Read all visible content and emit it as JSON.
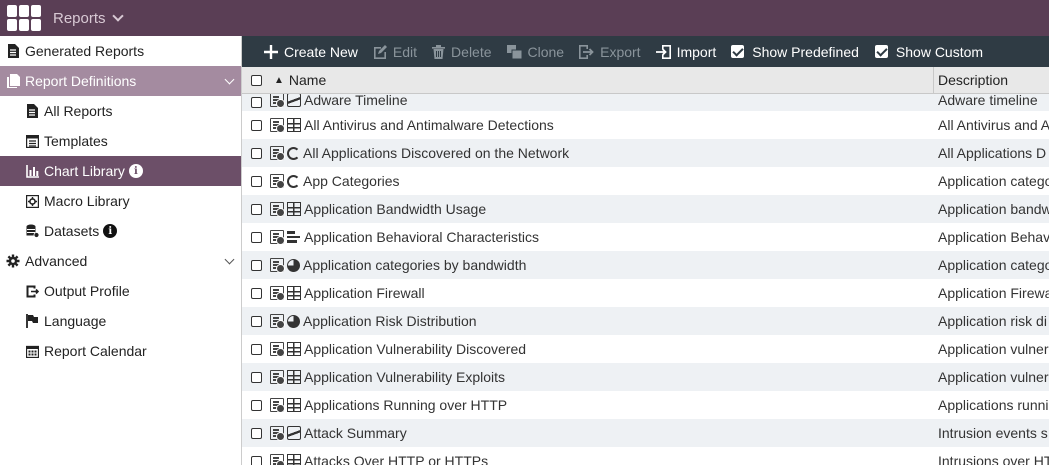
{
  "header": {
    "module_label": "Reports"
  },
  "sidebar": {
    "items": [
      {
        "label": "Generated Reports",
        "icon": "file-text-icon",
        "level": "top"
      },
      {
        "label": "Report Definitions",
        "icon": "file-copy-icon",
        "level": "top",
        "state": "group-open"
      },
      {
        "label": "All Reports",
        "icon": "file-text-icon",
        "level": "sub"
      },
      {
        "label": "Templates",
        "icon": "template-icon",
        "level": "sub"
      },
      {
        "label": "Chart Library",
        "icon": "bar-chart-icon",
        "level": "sub",
        "state": "active",
        "info": true
      },
      {
        "label": "Macro Library",
        "icon": "macro-icon",
        "level": "sub"
      },
      {
        "label": "Datasets",
        "icon": "dataset-icon",
        "level": "sub",
        "info": true
      },
      {
        "label": "Advanced",
        "icon": "gear-icon",
        "level": "top",
        "caret": true
      },
      {
        "label": "Output Profile",
        "icon": "output-icon",
        "level": "sub"
      },
      {
        "label": "Language",
        "icon": "flag-icon",
        "level": "sub"
      },
      {
        "label": "Report Calendar",
        "icon": "calendar-icon",
        "level": "sub"
      }
    ]
  },
  "toolbar": {
    "create_new": "Create New",
    "edit": "Edit",
    "delete": "Delete",
    "clone": "Clone",
    "export": "Export",
    "import": "Import",
    "show_predefined": "Show Predefined",
    "show_custom": "Show Custom"
  },
  "table": {
    "sort_indicator": "▲",
    "columns": {
      "name": "Name",
      "description": "Description"
    },
    "rows": [
      {
        "name": "Adware Timeline",
        "type": "area",
        "description": "Adware timeline"
      },
      {
        "name": "All Antivirus and Antimalware Detections",
        "type": "table",
        "description": "All Antivirus and A"
      },
      {
        "name": "All Applications Discovered on the Network",
        "type": "donut",
        "description": "All Applications D"
      },
      {
        "name": "App Categories",
        "type": "donut",
        "description": "Application catego"
      },
      {
        "name": "Application Bandwidth Usage",
        "type": "table",
        "description": "Application bandw"
      },
      {
        "name": "Application Behavioral Characteristics",
        "type": "bar",
        "description": "Application Behav"
      },
      {
        "name": "Application categories by bandwidth",
        "type": "pie",
        "description": "Application catego"
      },
      {
        "name": "Application Firewall",
        "type": "table",
        "description": "Application Firewa"
      },
      {
        "name": "Application Risk Distribution",
        "type": "pie",
        "description": "Application risk di"
      },
      {
        "name": "Application Vulnerability Discovered",
        "type": "table",
        "description": "Application vulner"
      },
      {
        "name": "Application Vulnerability Exploits",
        "type": "table",
        "description": "Application vulner"
      },
      {
        "name": "Applications Running over HTTP",
        "type": "table",
        "description": "Applications runni"
      },
      {
        "name": "Attack Summary",
        "type": "area",
        "description": "Intrusion events s"
      },
      {
        "name": "Attacks Over HTTP or HTTPs",
        "type": "table",
        "description": "Intrusions over HT"
      }
    ]
  }
}
